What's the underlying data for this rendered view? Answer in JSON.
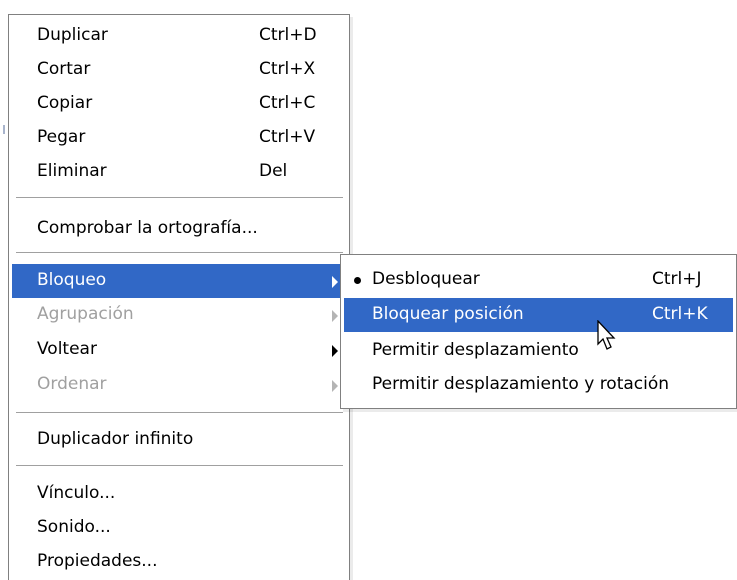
{
  "main_menu": {
    "items": [
      {
        "label": "Duplicar",
        "shortcut": "Ctrl+D"
      },
      {
        "label": "Cortar",
        "shortcut": "Ctrl+X"
      },
      {
        "label": "Copiar",
        "shortcut": "Ctrl+C"
      },
      {
        "label": "Pegar",
        "shortcut": "Ctrl+V"
      },
      {
        "label": "Eliminar",
        "shortcut": "Del"
      },
      {
        "label": "Comprobar la ortografía..."
      },
      {
        "label": "Bloqueo",
        "submenu": true,
        "state": "selected"
      },
      {
        "label": "Agrupación",
        "submenu": true,
        "state": "disabled"
      },
      {
        "label": "Voltear",
        "submenu": true
      },
      {
        "label": "Ordenar",
        "submenu": true,
        "state": "disabled"
      },
      {
        "label": "Duplicador infinito"
      },
      {
        "label": "Vínculo..."
      },
      {
        "label": "Sonido..."
      },
      {
        "label": "Propiedades..."
      }
    ]
  },
  "sub_menu": {
    "items": [
      {
        "label": "Desbloquear",
        "shortcut": "Ctrl+J",
        "checked": true
      },
      {
        "label": "Bloquear posición",
        "shortcut": "Ctrl+K",
        "state": "selected"
      },
      {
        "label": "Permitir desplazamiento"
      },
      {
        "label": "Permitir desplazamiento y rotación"
      }
    ]
  },
  "colors": {
    "selection": "#3168c6",
    "disabled_text": "#a0a0a0",
    "border": "#808080"
  },
  "cursor": {
    "icon": "arrow-pointer-icon"
  }
}
